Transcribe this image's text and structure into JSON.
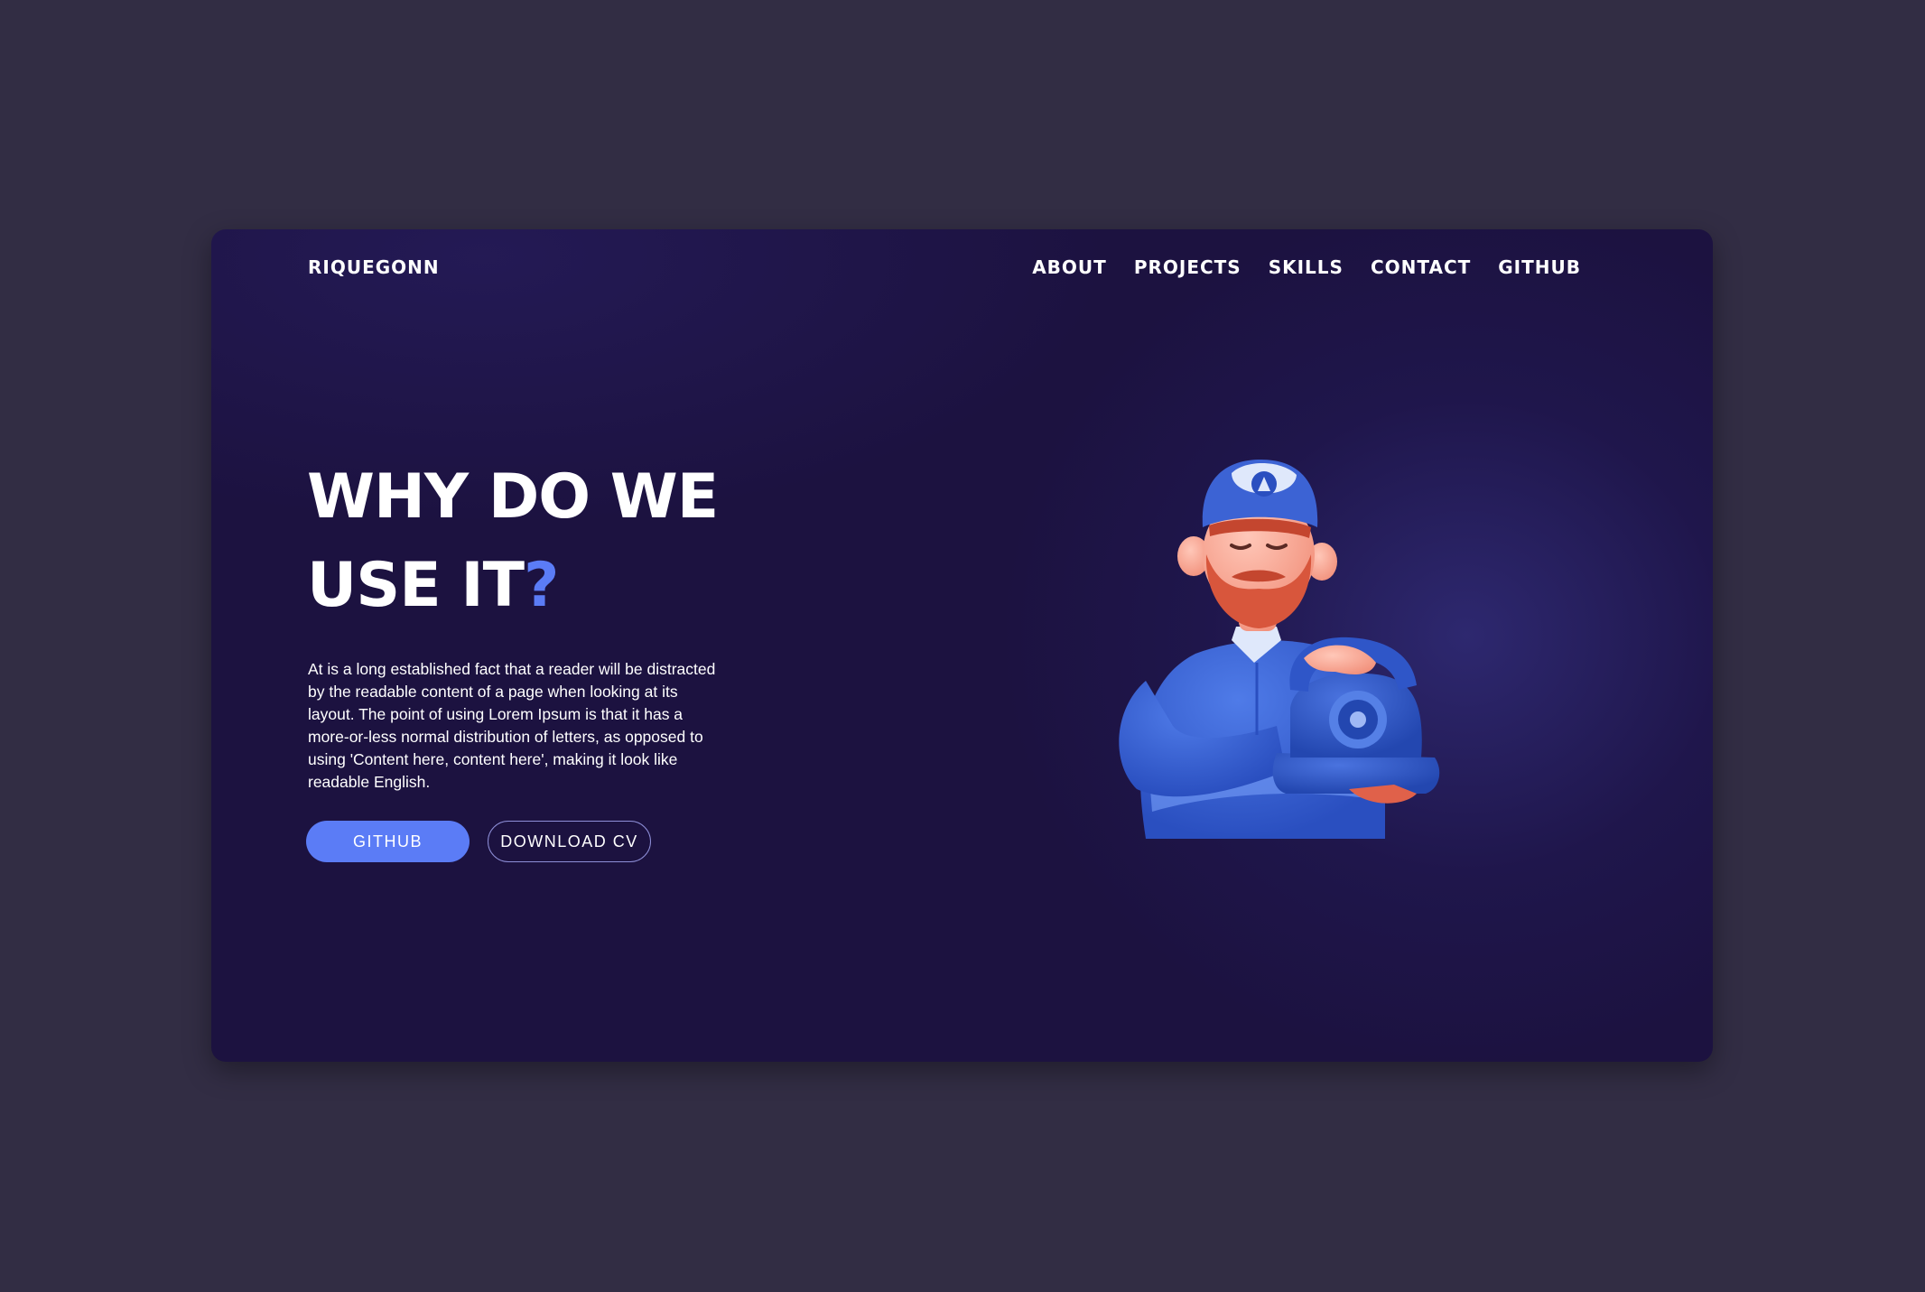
{
  "header": {
    "logo": "RIQUEGONN",
    "nav": [
      "ABOUT",
      "PROJECTS",
      "SKILLS",
      "CONTACT",
      "GITHUB"
    ]
  },
  "hero": {
    "title_line1": "WHY DO WE",
    "title_line2": "USE IT",
    "title_mark": "?",
    "description": "At is a long established fact that a reader will be distracted by the readable content of a page when looking at its layout. The point of using Lorem Ipsum is that it has a more-or-less normal distribution of letters, as opposed to using 'Content here, content here', making it look like readable English.",
    "primary_button": "GITHUB",
    "secondary_button": "DOWNLOAD CV"
  },
  "colors": {
    "page_bg": "#322d44",
    "card_bg": "#1c1240",
    "accent": "#5b7cf6",
    "text": "#ffffff"
  },
  "illustration": {
    "icon": "man-with-rotary-phone-illustration"
  }
}
